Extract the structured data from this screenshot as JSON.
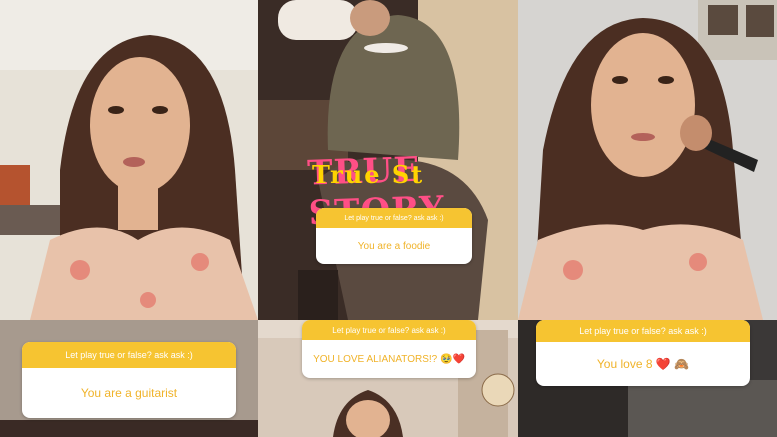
{
  "panels": {
    "left_top": {},
    "center_top": {
      "sticker_main": "TRUE STORY",
      "sticker_overlay": "True St",
      "question": "Let play true or false? ask ask :)",
      "answer": "You are a foodie"
    },
    "right_top": {},
    "left_bottom": {
      "question": "Let play true or false? ask ask :)",
      "answer": "You are a guitarist"
    },
    "center_bottom": {
      "question": "Let play true or false? ask ask :)",
      "answer": "YOU LOVE ALIANATORS!?",
      "emoji": "🥹",
      "heart": "❤️"
    },
    "right_bottom": {
      "question": "Let play true or false? ask ask :)",
      "answer": "You love 8",
      "heart": "❤️",
      "emoji": "🙈"
    }
  },
  "colors": {
    "question_header": "#f6c431",
    "answer_text": "#f0b32a",
    "sticker_pink": "#ff4f86",
    "sticker_yellow": "#ffd400"
  }
}
